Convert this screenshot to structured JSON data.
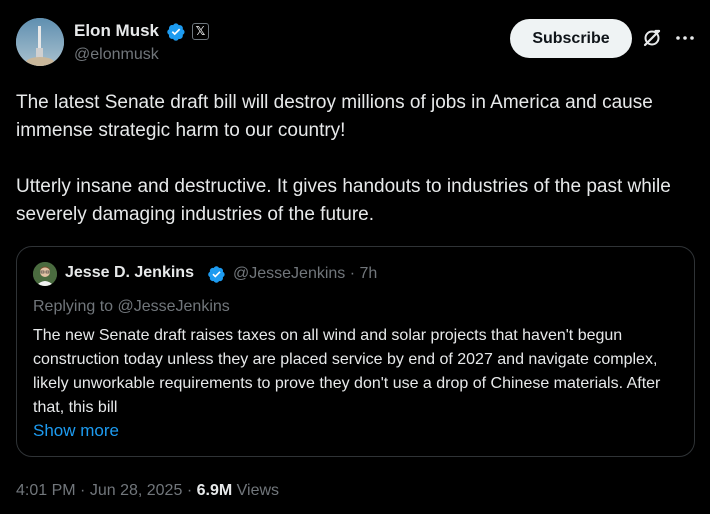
{
  "author": {
    "name": "Elon Musk",
    "handle": "@elonmusk",
    "x_badge": "𝕏"
  },
  "header": {
    "subscribe_label": "Subscribe"
  },
  "tweet": {
    "paragraph_1": "The latest Senate draft bill will destroy millions of jobs in America and cause immense strategic harm to our country!",
    "paragraph_2": "Utterly insane and destructive. It gives handouts to industries of the past while severely damaging industries of the future."
  },
  "quote": {
    "name": "Jesse D. Jenkins",
    "handle": "@JesseJenkins",
    "separator": "·",
    "time_ago": "7h",
    "replying_to": "Replying to @JesseJenkins",
    "text": "The new Senate draft raises taxes on all wind and solar projects that haven't begun construction today unless they are placed service by end of 2027 and navigate complex, likely unworkable requirements to prove they don't use a drop of Chinese materials. After that, this bill",
    "show_more_label": "Show more"
  },
  "footer": {
    "time": "4:01 PM",
    "date": "Jun 28, 2025",
    "separator": "·",
    "views_count": "6.9M",
    "views_label": "Views"
  },
  "colors": {
    "background": "#000000",
    "primary_text": "#e7e9ea",
    "secondary_text": "#71767b",
    "link": "#1d9bf0",
    "verified": "#1d9bf0",
    "border": "#2f3336",
    "button_bg": "#eff3f4"
  },
  "icons": {
    "verified": "verified-badge-icon",
    "x_badge": "x-logo-icon",
    "grok": "grok-icon",
    "more": "more-dots-icon"
  }
}
